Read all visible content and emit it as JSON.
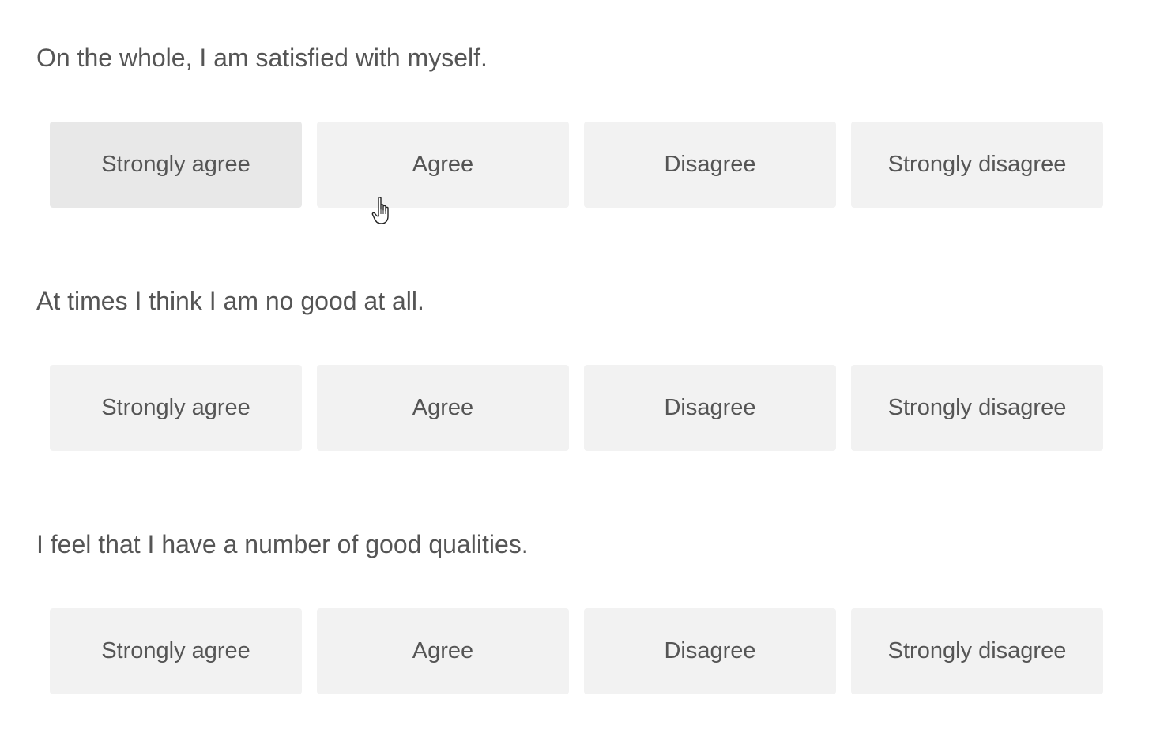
{
  "questions": [
    {
      "text": "On the whole, I am satisfied with myself.",
      "options": [
        "Strongly agree",
        "Agree",
        "Disagree",
        "Strongly disagree"
      ]
    },
    {
      "text": "At times I think I am no good at all.",
      "options": [
        "Strongly agree",
        "Agree",
        "Disagree",
        "Strongly disagree"
      ]
    },
    {
      "text": "I feel that I have a number of good qualities.",
      "options": [
        "Strongly agree",
        "Agree",
        "Disagree",
        "Strongly disagree"
      ]
    }
  ],
  "colors": {
    "option_bg": "#f2f2f2",
    "option_hover_bg": "#e8e8e8",
    "text": "#555555"
  },
  "cursor": "hand-pointer-icon"
}
